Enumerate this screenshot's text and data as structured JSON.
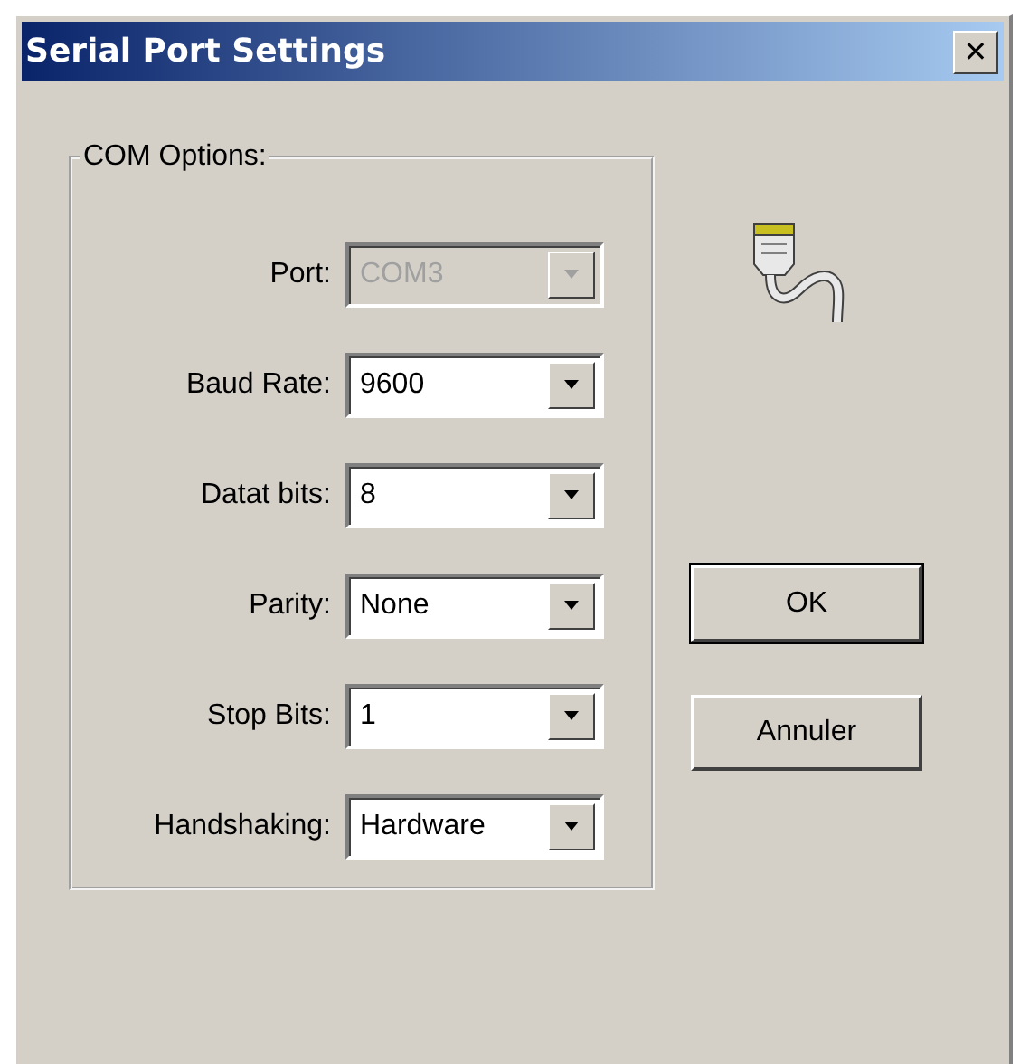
{
  "window": {
    "title": "Serial Port Settings",
    "close": "✕"
  },
  "group": {
    "title": "COM Options:",
    "fields": [
      {
        "label": "Port:",
        "value": "COM3",
        "disabled": true
      },
      {
        "label": "Baud Rate:",
        "value": "9600",
        "disabled": false
      },
      {
        "label": "Datat bits:",
        "value": "8",
        "disabled": false
      },
      {
        "label": "Parity:",
        "value": "None",
        "disabled": false
      },
      {
        "label": "Stop Bits:",
        "value": "1",
        "disabled": false
      },
      {
        "label": "Handshaking:",
        "value": "Hardware",
        "disabled": false
      }
    ]
  },
  "buttons": [
    {
      "label": "OK",
      "default": true
    },
    {
      "label": "Annuler",
      "default": false
    }
  ]
}
